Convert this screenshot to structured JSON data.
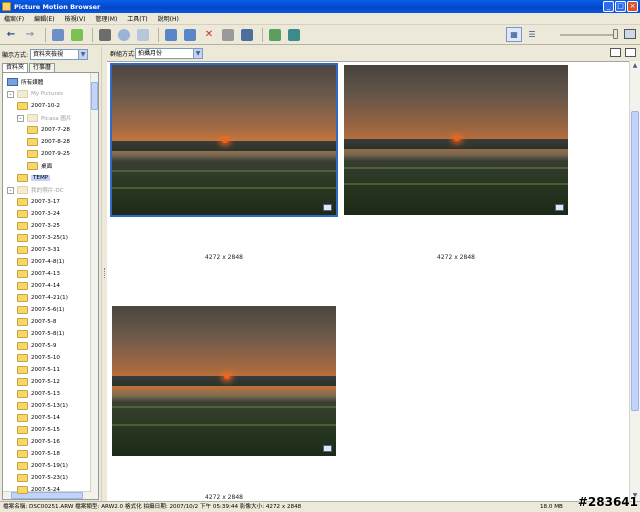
{
  "window": {
    "title": "Picture Motion Browser"
  },
  "menu": [
    "檔案(F)",
    "編輯(E)",
    "檢視(V)",
    "管理(M)",
    "工具(T)",
    "說明(H)"
  ],
  "toolbar": {
    "icons": [
      "back-arrow-icon",
      "forward-arrow-icon",
      "import-icon",
      "export-icon",
      "print-icon",
      "burn-disc-icon",
      "email-icon",
      "rotate-left-icon",
      "rotate-right-icon",
      "delete-icon",
      "image-fix-icon",
      "slideshow-icon",
      "map-icon",
      "convert-icon"
    ]
  },
  "left": {
    "view_label": "顯示方式:",
    "view_value": "資料夾檢視",
    "tabs": [
      "資料夾",
      "行事曆"
    ],
    "tree": [
      {
        "label": "所有媒體",
        "level": 0,
        "kind": "pc"
      },
      {
        "label": "My Pictures",
        "level": 0,
        "kind": "folder-dim",
        "expander": "-"
      },
      {
        "label": "2007-10-2",
        "level": 1,
        "kind": "folder"
      },
      {
        "label": "Picasa 圖片",
        "level": 1,
        "kind": "folder-dim",
        "expander": "-"
      },
      {
        "label": "2007-7-28",
        "level": 2,
        "kind": "folder"
      },
      {
        "label": "2007-8-28",
        "level": 2,
        "kind": "folder"
      },
      {
        "label": "2007-9-25",
        "level": 2,
        "kind": "folder"
      },
      {
        "label": "桌面",
        "level": 2,
        "kind": "folder"
      },
      {
        "label": "TEMP",
        "level": 1,
        "kind": "folder",
        "selected": true
      },
      {
        "label": "我的照片-DC",
        "level": 0,
        "kind": "folder-dim",
        "expander": "-"
      },
      {
        "label": "2007-3-17",
        "level": 1,
        "kind": "folder"
      },
      {
        "label": "2007-3-24",
        "level": 1,
        "kind": "folder"
      },
      {
        "label": "2007-3-25",
        "level": 1,
        "kind": "folder"
      },
      {
        "label": "2007-3-25(1)",
        "level": 1,
        "kind": "folder"
      },
      {
        "label": "2007-3-31",
        "level": 1,
        "kind": "folder"
      },
      {
        "label": "2007-4-8(1)",
        "level": 1,
        "kind": "folder"
      },
      {
        "label": "2007-4-13",
        "level": 1,
        "kind": "folder"
      },
      {
        "label": "2007-4-14",
        "level": 1,
        "kind": "folder"
      },
      {
        "label": "2007-4-21(1)",
        "level": 1,
        "kind": "folder"
      },
      {
        "label": "2007-5-6(1)",
        "level": 1,
        "kind": "folder"
      },
      {
        "label": "2007-5-8",
        "level": 1,
        "kind": "folder"
      },
      {
        "label": "2007-5-8(1)",
        "level": 1,
        "kind": "folder"
      },
      {
        "label": "2007-5-9",
        "level": 1,
        "kind": "folder"
      },
      {
        "label": "2007-5-10",
        "level": 1,
        "kind": "folder"
      },
      {
        "label": "2007-5-11",
        "level": 1,
        "kind": "folder"
      },
      {
        "label": "2007-5-12",
        "level": 1,
        "kind": "folder"
      },
      {
        "label": "2007-5-13",
        "level": 1,
        "kind": "folder"
      },
      {
        "label": "2007-5-13(1)",
        "level": 1,
        "kind": "folder"
      },
      {
        "label": "2007-5-14",
        "level": 1,
        "kind": "folder"
      },
      {
        "label": "2007-5-15",
        "level": 1,
        "kind": "folder"
      },
      {
        "label": "2007-5-16",
        "level": 1,
        "kind": "folder"
      },
      {
        "label": "2007-5-18",
        "level": 1,
        "kind": "folder"
      },
      {
        "label": "2007-5-19(1)",
        "level": 1,
        "kind": "folder"
      },
      {
        "label": "2007-5-23(1)",
        "level": 1,
        "kind": "folder"
      },
      {
        "label": "2007-5-24",
        "level": 1,
        "kind": "folder"
      }
    ]
  },
  "right": {
    "sort_label": "群組方式:",
    "sort_value": "拍攝月份",
    "thumbnails": [
      {
        "caption": "4272 x 2848",
        "selected": true
      },
      {
        "caption": "4272 x 2848",
        "selected": false
      },
      {
        "caption": "4272 x 2848",
        "selected": false
      }
    ]
  },
  "status": {
    "info": "檔案名稱: DSC00251.ARW  檔案類型: ARW2.0 格式化  拍攝日期: 2007/10/2 下午 05:39:44  影像大小: 4272 x 2848",
    "size": "18.0 MB"
  },
  "watermark": "#283641"
}
